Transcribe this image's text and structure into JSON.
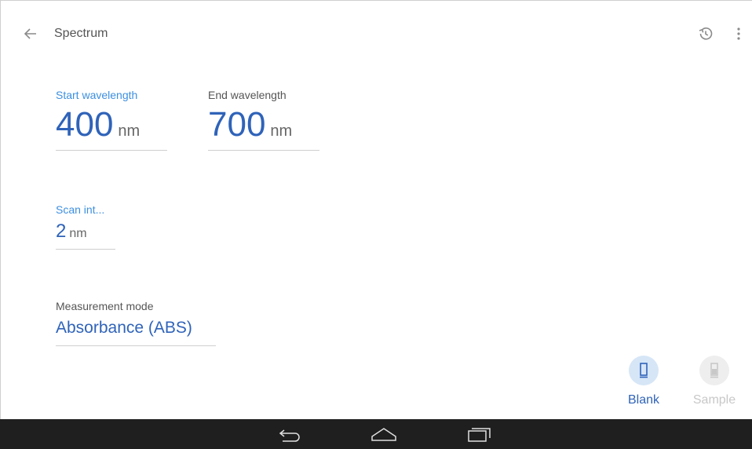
{
  "app": {
    "title": "Spectrum"
  },
  "icons": {
    "back": "arrow-left-icon",
    "history": "history-icon",
    "more": "more-vert-icon",
    "blank": "cuvette-icon",
    "sample": "cuvette-sample-icon"
  },
  "fields": {
    "start": {
      "label": "Start wavelength",
      "value": "400",
      "unit": "nm"
    },
    "end": {
      "label": "End wavelength",
      "value": "700",
      "unit": "nm"
    },
    "interval": {
      "label": "Scan int...",
      "value": "2",
      "unit": "nm"
    },
    "mode": {
      "label": "Measurement mode",
      "value": "Absorbance (ABS)"
    }
  },
  "actions": {
    "blank": {
      "label": "Blank",
      "state": "enabled"
    },
    "sample": {
      "label": "Sample",
      "state": "disabled"
    }
  },
  "colors": {
    "accent": "#2f63b9",
    "active_label": "#3d8fe0",
    "blank_circle": "#d6e6f7",
    "disabled": "#c8c8c8",
    "navbar": "#1f1f1f"
  }
}
